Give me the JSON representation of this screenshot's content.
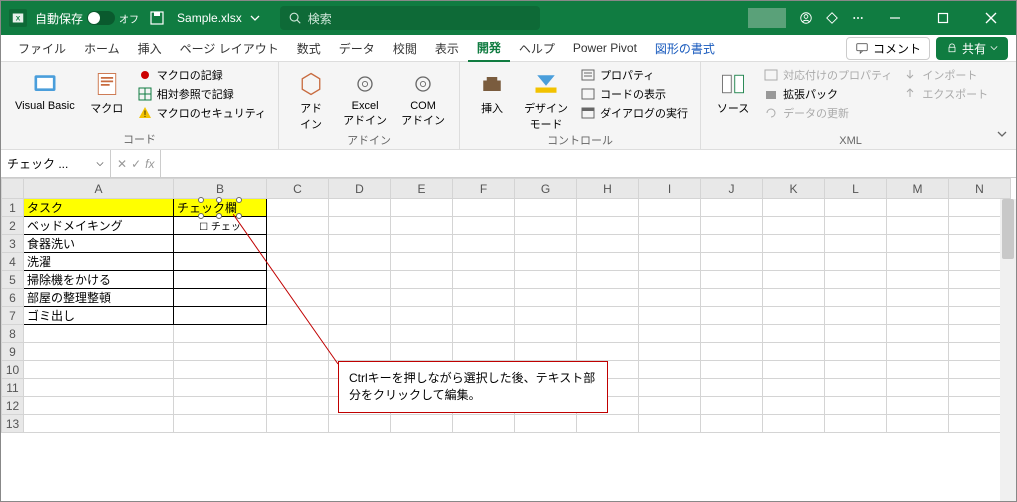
{
  "titlebar": {
    "autosave_label": "自動保存",
    "autosave_state": "オフ",
    "filename": "Sample.xlsx",
    "search_placeholder": "検索"
  },
  "tabs": {
    "items": [
      "ファイル",
      "ホーム",
      "挿入",
      "ページ レイアウト",
      "数式",
      "データ",
      "校閲",
      "表示",
      "開発",
      "ヘルプ",
      "Power Pivot",
      "図形の書式"
    ],
    "active_index": 8,
    "comment_label": "コメント",
    "share_label": "共有"
  },
  "ribbon": {
    "groups": [
      {
        "label": "コード",
        "large": [
          {
            "name": "Visual Basic"
          },
          {
            "name": "マクロ"
          }
        ],
        "list": [
          "マクロの記録",
          "相対参照で記録",
          "マクロのセキュリティ"
        ]
      },
      {
        "label": "アドイン",
        "large": [
          {
            "name": "アド\nイン"
          },
          {
            "name": "Excel\nアドイン"
          },
          {
            "name": "COM\nアドイン"
          }
        ]
      },
      {
        "label": "コントロール",
        "large": [
          {
            "name": "挿入"
          },
          {
            "name": "デザイン\nモード"
          }
        ],
        "list": [
          "プロパティ",
          "コードの表示",
          "ダイアログの実行"
        ]
      },
      {
        "label": "XML",
        "large": [
          {
            "name": "ソース"
          }
        ],
        "list": [
          "対応付けのプロパティ",
          "拡張パック",
          "データの更新"
        ],
        "list2": [
          "インポート",
          "エクスポート"
        ]
      }
    ]
  },
  "formula_bar": {
    "name_box": "チェック ..."
  },
  "grid": {
    "columns": [
      "A",
      "B",
      "C",
      "D",
      "E",
      "F",
      "G",
      "H",
      "I",
      "J",
      "K",
      "L",
      "M",
      "N"
    ],
    "rows": [
      1,
      2,
      3,
      4,
      5,
      6,
      7,
      8,
      9,
      10,
      11,
      12,
      13
    ],
    "headers": {
      "A1": "タスク",
      "B1": "チェック欄"
    },
    "data": {
      "A2": "ベッドメイキング",
      "A3": "食器洗い",
      "A4": "洗濯",
      "A5": "掃除機をかける",
      "A6": "部屋の整理整頓",
      "A7": "ゴミ出し",
      "B2": "チェッ"
    }
  },
  "callout": {
    "text": "Ctrlキーを押しながら選択した後、テキスト部分をクリックして編集。"
  }
}
